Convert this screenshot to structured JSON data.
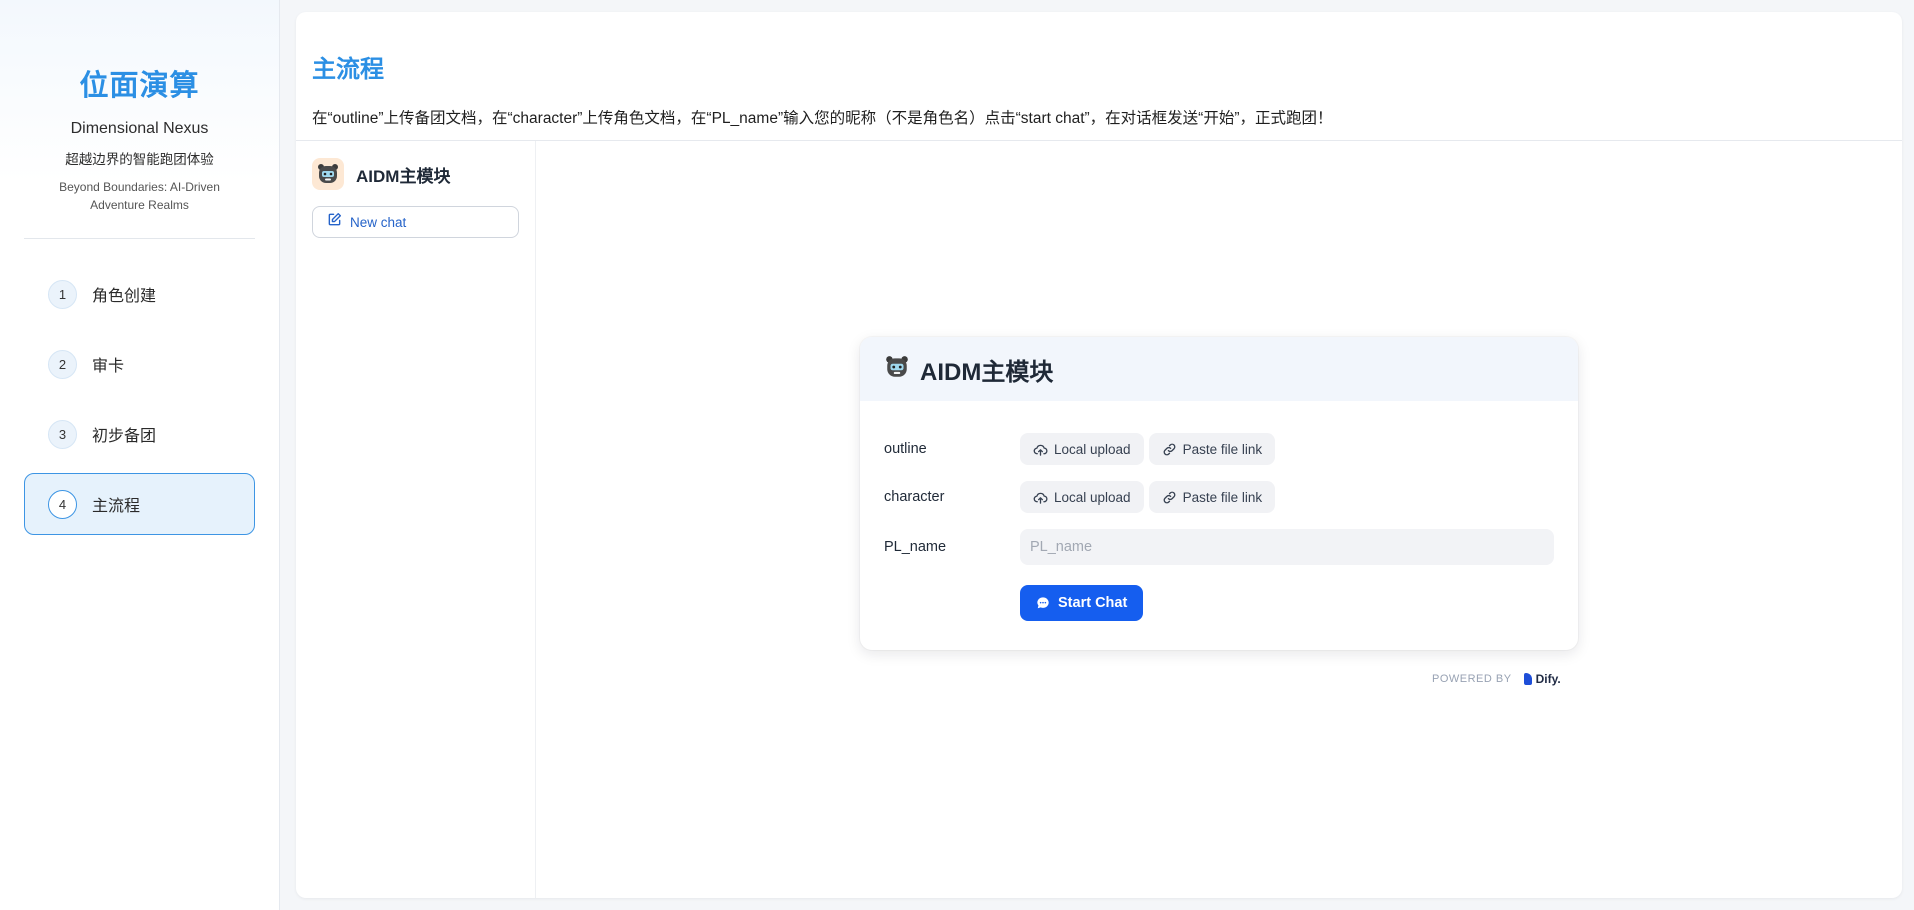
{
  "sidebar": {
    "brand_title": "位面演算",
    "brand_subtitle_en": "Dimensional Nexus",
    "brand_subtitle_cn": "超越边界的智能跑团体验",
    "brand_tagline": "Beyond Boundaries: AI-Driven Adventure Realms",
    "items": [
      {
        "num": "1",
        "label": "角色创建",
        "active": false
      },
      {
        "num": "2",
        "label": "审卡",
        "active": false
      },
      {
        "num": "3",
        "label": "初步备团",
        "active": false
      },
      {
        "num": "4",
        "label": "主流程",
        "active": true
      }
    ]
  },
  "main": {
    "title": "主流程",
    "description": "在“outline”上传备团文档，在“character”上传角色文档，在“PL_name”输入您的昵称（不是角色名）点击“start chat”，在对话框发送“开始”，正式跑团！"
  },
  "chat_app": {
    "name": "AIDM主模块",
    "new_chat_label": "New chat",
    "welcome_title": "AIDM主模块",
    "fields": {
      "outline": {
        "label": "outline",
        "local_upload": "Local upload",
        "paste_link": "Paste file link"
      },
      "character": {
        "label": "character",
        "local_upload": "Local upload",
        "paste_link": "Paste file link"
      },
      "pl_name": {
        "label": "PL_name",
        "placeholder": "PL_name",
        "value": ""
      }
    },
    "start_chat_label": "Start Chat",
    "powered_by": "POWERED BY",
    "powered_brand": "Dify."
  },
  "colors": {
    "accent": "#2b8fe4",
    "primary_button": "#155eef",
    "active_nav_bg": "#e6f2fc"
  },
  "icons": {
    "bot_avatar": "robot-bear-icon",
    "new_chat": "edit-icon",
    "upload": "cloud-upload-icon",
    "link": "link-icon",
    "start_chat": "chat-bubble-icon"
  }
}
